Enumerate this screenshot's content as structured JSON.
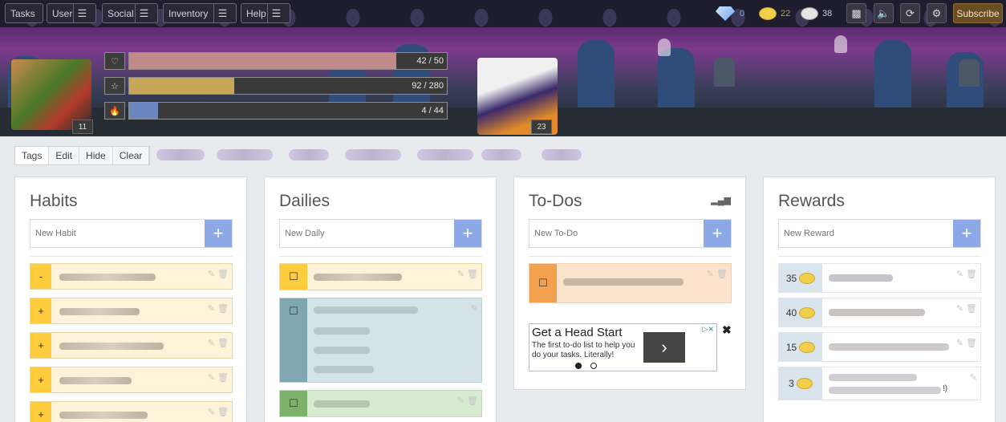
{
  "nav": {
    "tasks": "Tasks",
    "user": "User",
    "social": "Social",
    "inventory": "Inventory",
    "help": "Help",
    "gems": "0",
    "gold": "22",
    "silver": "38",
    "subscribe": "Subscribe",
    "icons": [
      "chat-icon",
      "mute-icon",
      "sync-icon",
      "settings-icon"
    ]
  },
  "stats": {
    "health": {
      "value": "42 / 50",
      "fraction": 0.84,
      "color": "#c08a8a"
    },
    "experience": {
      "value": "92 / 280",
      "fraction": 0.33,
      "color": "#c7a757"
    },
    "mana": {
      "value": "4 / 44",
      "fraction": 0.09,
      "color": "#6c86c0"
    },
    "level_player": "11",
    "level_party": "23"
  },
  "filters": {
    "tags": "Tags",
    "edit": "Edit",
    "hide": "Hide",
    "clear": "Clear"
  },
  "habits": {
    "title": "Habits",
    "placeholder": "New Habit",
    "items": [
      {
        "ctrl": "-"
      },
      {
        "ctrl": "+"
      },
      {
        "ctrl": "+"
      },
      {
        "ctrl": "+"
      },
      {
        "ctrl": "+"
      }
    ]
  },
  "dailies": {
    "title": "Dailies",
    "placeholder": "New Daily"
  },
  "todos": {
    "title": "To-Dos",
    "placeholder": "New To-Do",
    "ad": {
      "headline": "Get a Head Start",
      "body": "The first to-do list to help you do your tasks. Literally!"
    }
  },
  "rewards": {
    "title": "Rewards",
    "placeholder": "New Reward",
    "items": [
      {
        "price": "35"
      },
      {
        "price": "40"
      },
      {
        "price": "15"
      },
      {
        "price": "3"
      }
    ],
    "fragment": "!)"
  },
  "colors": {
    "accent": "#8ca8e6",
    "habit_bg": "#fdf3d9",
    "control_yellow": "#ffcc3d"
  }
}
